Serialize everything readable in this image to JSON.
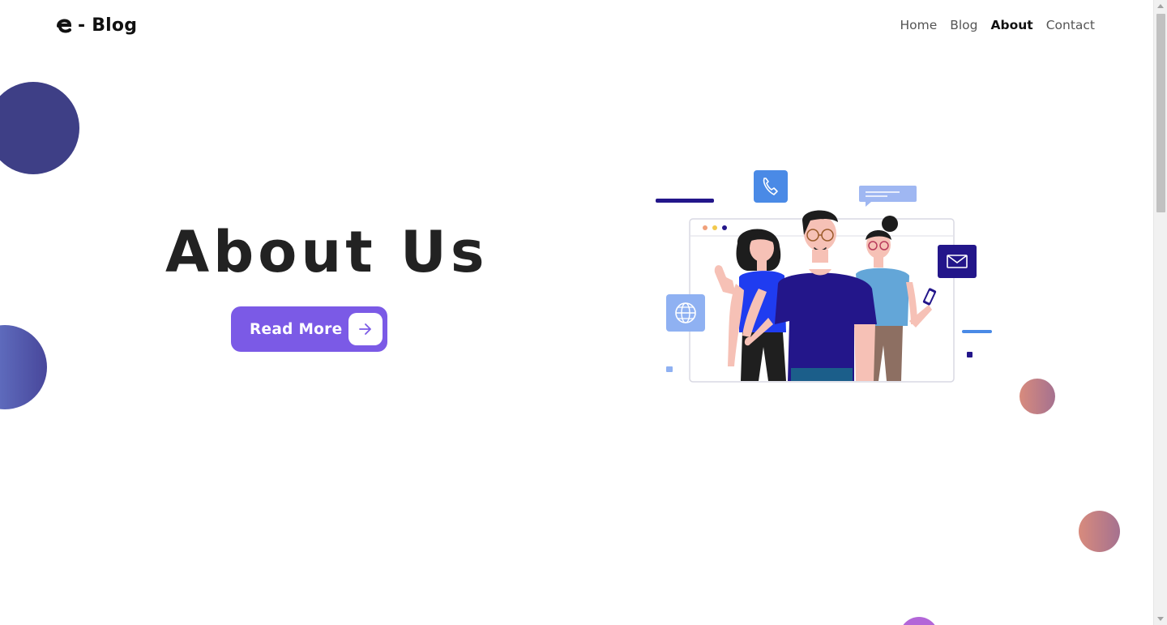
{
  "header": {
    "logo_text": "- Blog",
    "logo_icon": "e-logo-icon",
    "nav": [
      {
        "label": "Home"
      },
      {
        "label": "Blog"
      },
      {
        "label": "About",
        "active": true
      },
      {
        "label": "Contact"
      }
    ]
  },
  "hero": {
    "title": "About Us",
    "button_label": "Read More",
    "button_icon": "arrow-right-icon"
  },
  "colors": {
    "accent": "#7b5ae6",
    "dark_circle": "#3e3f86",
    "illustration_navy": "#23168a",
    "illustration_blue": "#4a8ae6"
  },
  "illustration": {
    "name": "team-illustration",
    "icons": [
      "phone-icon",
      "chat-bubble-icon",
      "mail-icon",
      "globe-icon"
    ]
  }
}
